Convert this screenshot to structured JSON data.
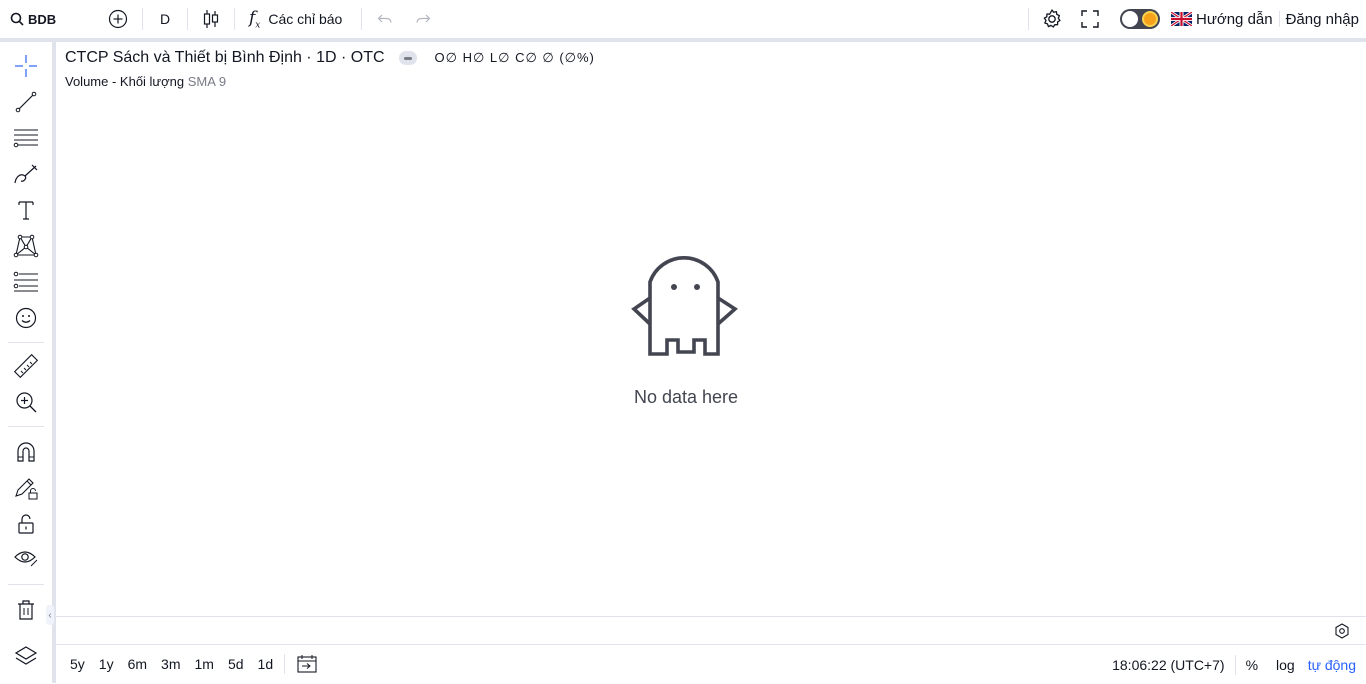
{
  "header": {
    "symbol": "BDB",
    "interval": "D",
    "indicators_label": "Các chỉ báo",
    "guide_label": "Hướng dẫn",
    "login_label": "Đăng nhập"
  },
  "legend": {
    "title": "CTCP Sách và Thiết bị Bình Định · 1D · OTC",
    "ohlc": "O∅ H∅ L∅ C∅ ∅ (∅%)",
    "volume_label": "Volume - Khối lượng",
    "volume_sma": "SMA 9"
  },
  "empty_state": {
    "message": "No data here"
  },
  "bottom": {
    "ranges": [
      "5y",
      "1y",
      "6m",
      "3m",
      "1m",
      "5d",
      "1d"
    ],
    "time": "18:06:22 (UTC+7)",
    "percent": "%",
    "log": "log",
    "auto": "tự động",
    "auto_color": "#2962ff"
  },
  "sidebar_tools": [
    "crosshair-icon",
    "trend-line-icon",
    "fib-icon",
    "brush-icon",
    "text-icon",
    "pattern-icon",
    "prediction-icon",
    "emoji-icon",
    "ruler-icon",
    "zoom-in-icon",
    "magnet-icon",
    "lock-drawing-icon",
    "lock-icon",
    "eye-icon",
    "trash-icon",
    "layers-icon"
  ]
}
